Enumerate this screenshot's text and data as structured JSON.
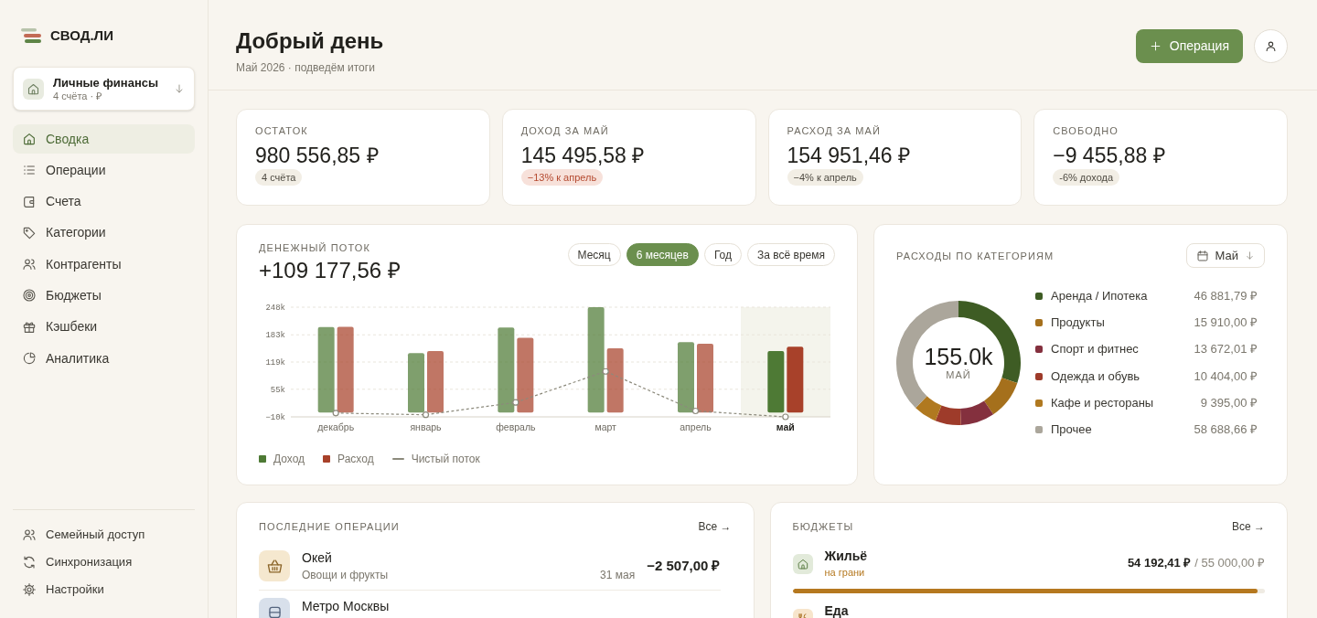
{
  "sidebar": {
    "logo": "СВОД.ЛИ",
    "workspace": {
      "name": "Личные финансы",
      "meta": "4 счёта · ₽"
    },
    "nav": [
      {
        "label": "Сводка",
        "selected": true
      },
      {
        "label": "Операции",
        "selected": false
      },
      {
        "label": "Счета",
        "selected": false
      },
      {
        "label": "Категории",
        "selected": false
      },
      {
        "label": "Контрагенты",
        "selected": false
      },
      {
        "label": "Бюджеты",
        "selected": false
      },
      {
        "label": "Кэшбеки",
        "selected": false
      },
      {
        "label": "Аналитика",
        "selected": false
      }
    ],
    "footer_nav": [
      {
        "label": "Семейный доступ"
      },
      {
        "label": "Синхронизация"
      },
      {
        "label": "Настройки"
      }
    ]
  },
  "header": {
    "title": "Добрый день",
    "subtitle": "Май 2026 · подведём итоги",
    "primary_button": "Операция"
  },
  "kpis": [
    {
      "label": "ОСТАТОК",
      "value": "980 556,85 ₽",
      "badge": "4 счёта",
      "kind": "neutral"
    },
    {
      "label": "ДОХОД ЗА МАЙ",
      "value": "145 495,58 ₽",
      "badge": "−13% к апрель",
      "kind": "negative"
    },
    {
      "label": "РАСХОД ЗА МАЙ",
      "value": "154 951,46 ₽",
      "badge": "−4% к апрель",
      "kind": "neutral"
    },
    {
      "label": "СВОБОДНО",
      "value": "−9 455,88 ₽",
      "badge": "-6% дохода",
      "kind": "neutral"
    }
  ],
  "cash_flow": {
    "title": "ДЕНЕЖНЫЙ ПОТОК",
    "total": "+109 177,56 ₽",
    "ranges": [
      {
        "label": "Месяц",
        "selected": false
      },
      {
        "label": "6 месяцев",
        "selected": true
      },
      {
        "label": "Год",
        "selected": false
      },
      {
        "label": "За всё время",
        "selected": false
      }
    ],
    "month_columns": [
      {
        "selected": false
      },
      {
        "selected": false
      },
      {
        "selected": false
      },
      {
        "selected": false
      },
      {
        "selected": false
      },
      {
        "selected": true
      }
    ],
    "chart_data": {
      "type": "bar",
      "categories": [
        "декабрь",
        "январь",
        "февраль",
        "март",
        "апрель",
        "май"
      ],
      "series": [
        {
          "name": "Доход",
          "color": "#4e7a35",
          "values": [
            201,
            140,
            200,
            248,
            166,
            145
          ]
        },
        {
          "name": "Расход",
          "color": "#a8412a",
          "values": [
            202,
            145,
            176,
            151,
            162,
            155
          ]
        },
        {
          "name": "Чистый поток",
          "color": "#8c8a7c",
          "type": "line",
          "line_style": "dashed",
          "marker": "circle",
          "values": [
            -1,
            -5,
            24,
            97,
            4,
            -10
          ]
        }
      ],
      "ylim": [
        -10,
        248
      ],
      "yticks": [
        {
          "value": -10,
          "label": "−10k"
        },
        {
          "value": 55,
          "label": "55k"
        },
        {
          "value": 119,
          "label": "119k"
        },
        {
          "value": 183,
          "label": "183k"
        },
        {
          "value": 248,
          "label": "248k"
        }
      ],
      "grid": true
    }
  },
  "expenses_by_category": {
    "title": "РАСХОДЫ ПО КАТЕГОРИЯМ",
    "period": "Май",
    "center_value": "155.0k",
    "center_label": "МАЙ",
    "items": [
      {
        "amount": "46 881,79 ₽",
        "color": "#3e5c24"
      },
      {
        "amount": "15 910,00 ₽",
        "color": "#a5701c"
      },
      {
        "amount": "13 672,01 ₽",
        "color": "#84303e"
      },
      {
        "amount": "10 404,00 ₽",
        "color": "#9e3b2a"
      },
      {
        "amount": "9 395,00 ₽",
        "color": "#b07920"
      },
      {
        "amount": "58 688,66 ₽",
        "color": "#aba69b"
      }
    ],
    "chart_data": {
      "type": "donut",
      "categories": [
        "Аренда / Ипотека",
        "Продукты",
        "Спорт и фитнес",
        "Одежда и обувь",
        "Кафе и рестораны",
        "Прочее"
      ],
      "values": [
        30.26,
        10.27,
        8.82,
        6.71,
        6.06,
        37.88
      ]
    }
  },
  "recent_operations": {
    "title": "ПОСЛЕДНИЕ ОПЕРАЦИИ",
    "link": "Все →",
    "rows": [
      {
        "name": "Окей",
        "category": "Овощи и фрукты",
        "date": "31 мая",
        "amount": "−2 507,00 ₽"
      },
      {
        "name": "Метро Москвы"
      }
    ]
  },
  "budgets": {
    "title": "БЮДЖЕТЫ",
    "link": "Все →",
    "items": [
      {
        "name": "Жильё",
        "status": "на грани",
        "spent": "54 192,41 ₽",
        "limit": "/ 55 000,00 ₽",
        "level": 0.985,
        "color": "#b5781f"
      },
      {
        "name": "Еда"
      }
    ]
  }
}
